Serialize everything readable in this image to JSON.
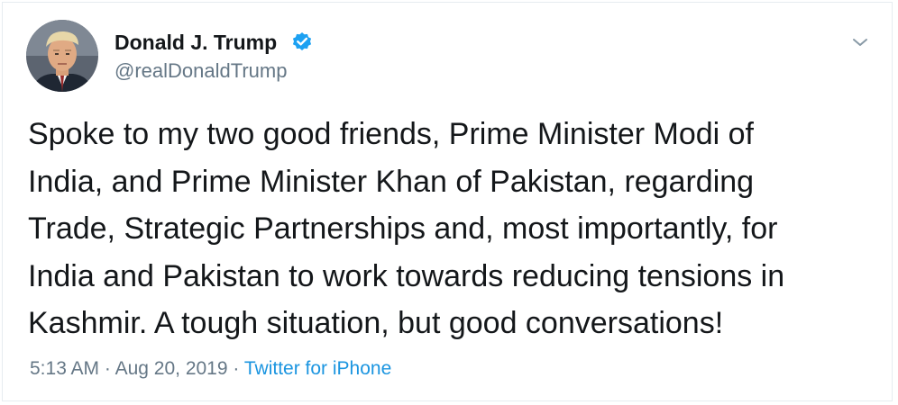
{
  "author": {
    "name": "Donald J. Trump",
    "handle": "@realDonaldTrump",
    "verified": true
  },
  "tweet": {
    "text": "Spoke to my two good friends, Prime Minister Modi of\nIndia, and Prime Minister Khan of Pakistan, regarding\nTrade, Strategic Partnerships and, most importantly, for\nIndia and Pakistan to work towards reducing tensions in\nKashmir. A tough situation, but good conversations!",
    "time": "5:13 AM",
    "separator": "·",
    "date": "Aug 20, 2019",
    "source": "Twitter for iPhone"
  },
  "icons": {
    "verified": "verified-badge-icon",
    "menu": "chevron-down-icon"
  },
  "colors": {
    "name": "#14171a",
    "secondary": "#657786",
    "link": "#1b95e0",
    "verified": "#1da1f2",
    "border": "#e6ecf0"
  }
}
